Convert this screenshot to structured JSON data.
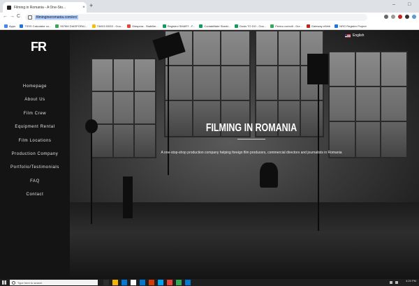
{
  "browser": {
    "tab_title": "Filming in Romania - A One-Sto...",
    "new_tab": "+",
    "close_tab": "×",
    "window_min": "–",
    "window_max": "□",
    "url": "filmingineromania.com/en/",
    "back": "←",
    "forward": "→",
    "reload": "C"
  },
  "bookmarks": [
    {
      "label": "Apps",
      "color": "#4285f4"
    },
    {
      "label": "TSSS Calculator co...",
      "color": "#1a73e8"
    },
    {
      "label": "5576M DIASPORA i...",
      "color": "#34a853"
    },
    {
      "label": "7/6003 53/53 - Goo...",
      "color": "#fbbc04"
    },
    {
      "label": "Diaspora - Stabilire...",
      "color": "#ea4335"
    },
    {
      "label": "Registrul SMART - F...",
      "color": "#0f9d58"
    },
    {
      "label": "Contabilitate Stanki...",
      "color": "#0f9d58"
    },
    {
      "label": "Dosis TO DO - Goo...",
      "color": "#0f9d58"
    },
    {
      "label": "Pentru coerciti - Dur...",
      "color": "#34a853"
    },
    {
      "label": "Gateway eWeb",
      "color": "#c5221f"
    },
    {
      "label": "NRG Register Project",
      "color": "#1a73e8"
    }
  ],
  "site": {
    "logo": "FR",
    "language": "English",
    "menu": [
      "Homepage",
      "About Us",
      "Film Crew",
      "Equipment Rental",
      "Film Locations",
      "Production Company",
      "Portfolio/Testimonials",
      "FAQ",
      "Contact"
    ],
    "hero_title": "FILMING IN ROMANIA",
    "hero_subtitle": "A one-stop-shop production company helping foreign film producers, commercial directors and journalists in Romania"
  },
  "taskbar": {
    "search_placeholder": "Type here to search",
    "time": "4:20 PM",
    "date": "...",
    "apps": [
      "#2d2d2d",
      "#f4b400",
      "#0078d4",
      "#ffffff",
      "#0078d4",
      "#d83b01",
      "#00a4ef",
      "#ea4335",
      "#34a853",
      "#0078d4"
    ]
  },
  "colors": {
    "sidebar_bg": "#141414",
    "accent_text": "#ffffff"
  }
}
